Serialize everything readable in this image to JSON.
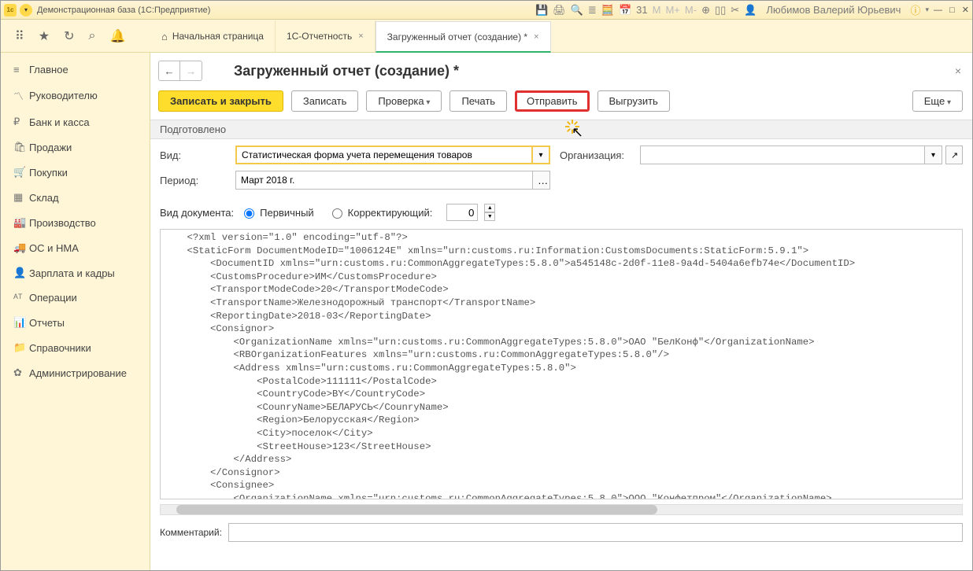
{
  "titlebar": {
    "app_badge": "1c",
    "title": "Демонстрационная база  (1С:Предприятие)",
    "user_name": "Любимов Валерий Юрьевич"
  },
  "top_icons": [
    "⠿",
    "★",
    "↻",
    "⌕",
    "🔔"
  ],
  "tabs": [
    {
      "label": "Начальная страница",
      "closable": false,
      "home": true
    },
    {
      "label": "1С-Отчетность",
      "closable": true
    },
    {
      "label": "Загруженный отчет (создание) *",
      "closable": true,
      "active": true
    }
  ],
  "sidebar": [
    {
      "icon": "≡",
      "label": "Главное"
    },
    {
      "icon": "〽",
      "label": "Руководителю"
    },
    {
      "icon": "₽",
      "label": "Банк и касса"
    },
    {
      "icon": "🛍",
      "label": "Продажи"
    },
    {
      "icon": "🛒",
      "label": "Покупки"
    },
    {
      "icon": "▦",
      "label": "Склад"
    },
    {
      "icon": "🏭",
      "label": "Производство"
    },
    {
      "icon": "🚚",
      "label": "ОС и НМА"
    },
    {
      "icon": "👤",
      "label": "Зарплата и кадры"
    },
    {
      "icon": "ᴬᵀ",
      "label": "Операции"
    },
    {
      "icon": "📊",
      "label": "Отчеты"
    },
    {
      "icon": "📁",
      "label": "Справочники"
    },
    {
      "icon": "✿",
      "label": "Администрирование"
    }
  ],
  "page": {
    "title": "Загруженный отчет (создание) *",
    "toolbar": {
      "save_close": "Записать и закрыть",
      "save": "Записать",
      "check": "Проверка",
      "print": "Печать",
      "send": "Отправить",
      "export": "Выгрузить",
      "more": "Еще"
    },
    "status": "Подготовлено",
    "form": {
      "vid_label": "Вид:",
      "vid_value": "Статистическая форма учета перемещения товаров",
      "org_label": "Организация:",
      "org_value": "",
      "period_label": "Период:",
      "period_value": "Март 2018 г.",
      "doc_kind_label": "Вид документа:",
      "radio_primary": "Первичный",
      "radio_corrective": "Корректирующий:",
      "corrective_num": "0",
      "comment_label": "Комментарий:",
      "comment_value": ""
    },
    "xml": "    <?xml version=\"1.0\" encoding=\"utf-8\"?>\n    <StaticForm DocumentModeID=\"1006124E\" xmlns=\"urn:customs.ru:Information:CustomsDocuments:StaticForm:5.9.1\">\n        <DocumentID xmlns=\"urn:customs.ru:CommonAggregateTypes:5.8.0\">a545148c-2d0f-11e8-9a4d-5404a6efb74e</DocumentID>\n        <CustomsProcedure>ИМ</CustomsProcedure>\n        <TransportModeCode>20</TransportModeCode>\n        <TransportName>Железнодорожный транспорт</TransportName>\n        <ReportingDate>2018-03</ReportingDate>\n        <Consignor>\n            <OrganizationName xmlns=\"urn:customs.ru:CommonAggregateTypes:5.8.0\">ОАО \"БелКонф\"</OrganizationName>\n            <RBOrganizationFeatures xmlns=\"urn:customs.ru:CommonAggregateTypes:5.8.0\"/>\n            <Address xmlns=\"urn:customs.ru:CommonAggregateTypes:5.8.0\">\n                <PostalCode>111111</PostalCode>\n                <CountryCode>BY</CountryCode>\n                <CounryName>БЕЛАРУСЬ</CounryName>\n                <Region>Белорусская</Region>\n                <City>поселок</City>\n                <StreetHouse>123</StreetHouse>\n            </Address>\n        </Consignor>\n        <Consignee>\n            <OrganizationName xmlns=\"urn:customs.ru:CommonAggregateTypes:5.8.0\">ООО \"Конфетпром\"</OrganizationName>\n            <RFOrganizationFeatures xmlns=\"urn:customs.ru:CommonAggregateTypes:5.8.0\">"
  }
}
